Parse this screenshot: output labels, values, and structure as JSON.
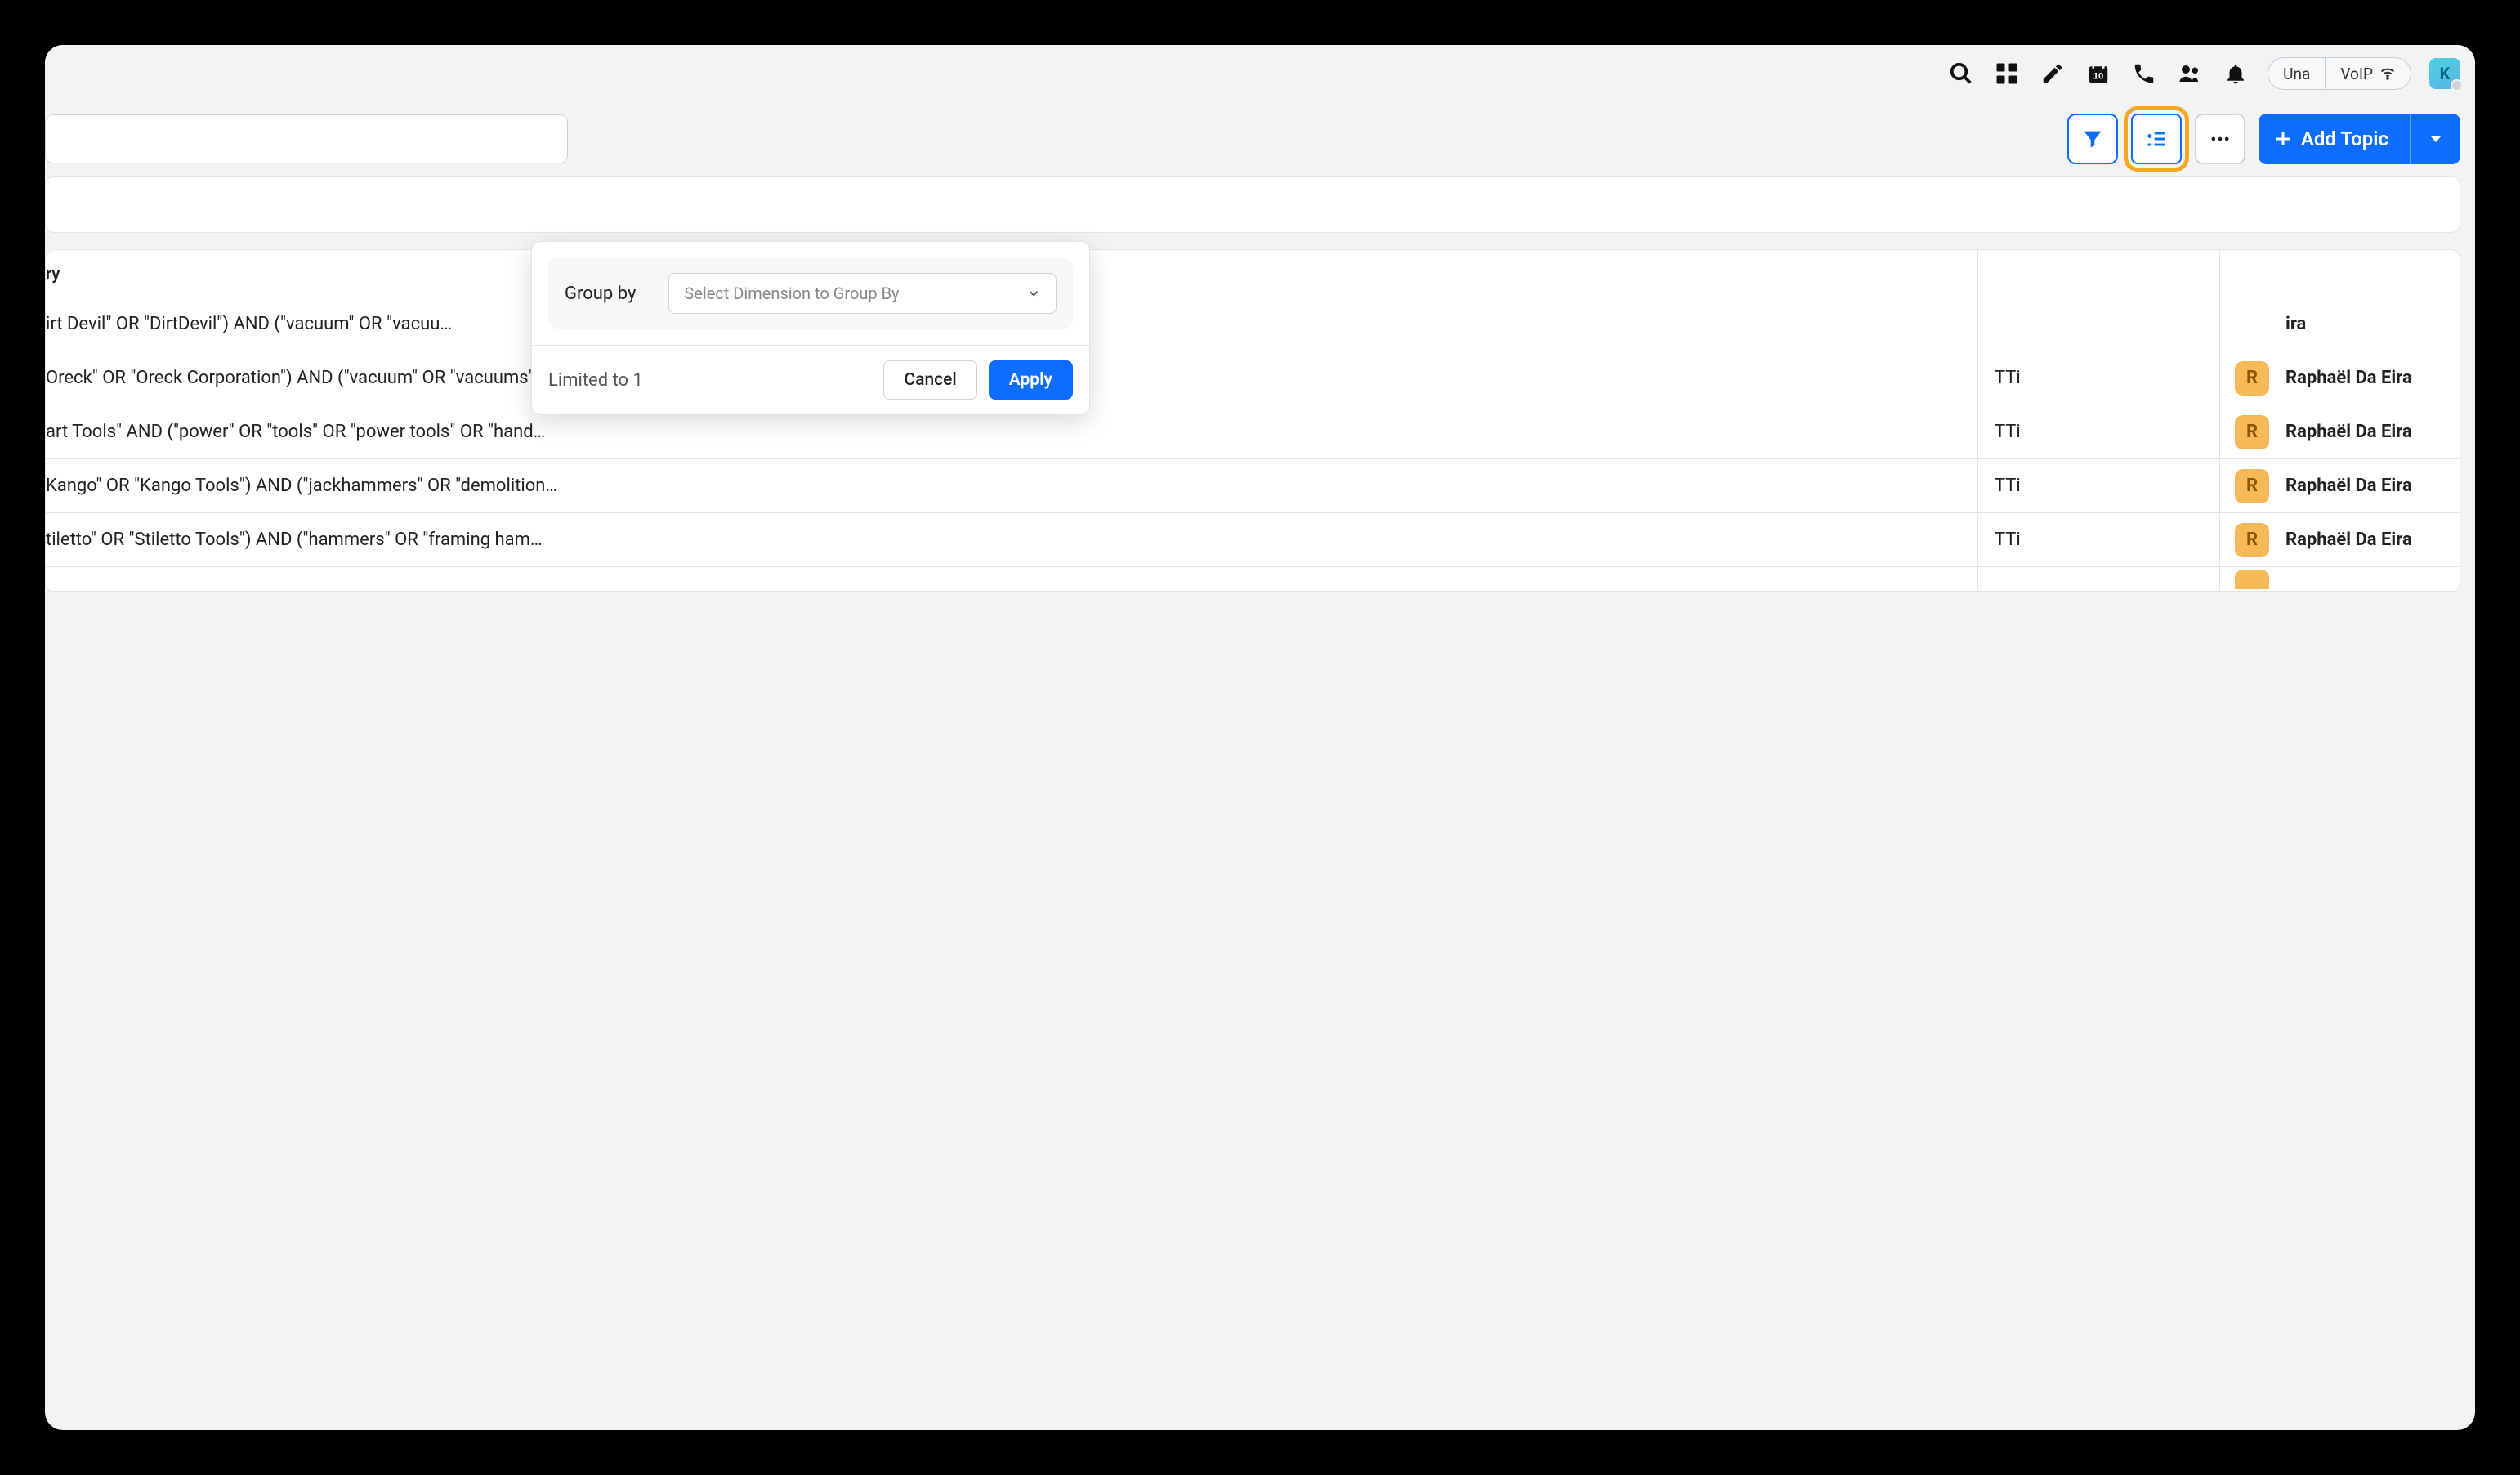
{
  "header": {
    "user_badge": "Una",
    "voip_label": "VoIP",
    "avatar_letter": "K"
  },
  "toolbar": {
    "add_label": "Add Topic"
  },
  "popover": {
    "group_by_label": "Group by",
    "select_placeholder": "Select Dimension to Group By",
    "limited_text": "Limited to 1",
    "cancel_label": "Cancel",
    "apply_label": "Apply"
  },
  "table": {
    "header_query_fragment": "ry",
    "rows": [
      {
        "query": "irt Devil\" OR \"DirtDevil\") AND (\"vacuum\" OR \"vacuu…",
        "customer": "",
        "owner": "ira",
        "owner_tag": ""
      },
      {
        "query": "Oreck\" OR \"Oreck Corporation\") AND (\"vacuum\" OR \"vacuums\" …",
        "customer": "TTi",
        "owner": "Raphaël Da Eira",
        "owner_tag": "R"
      },
      {
        "query": "art Tools\" AND (\"power\" OR \"tools\" OR \"power tools\" OR \"hand…",
        "customer": "TTi",
        "owner": "Raphaël Da Eira",
        "owner_tag": "R"
      },
      {
        "query": "Kango\" OR \"Kango Tools\") AND (\"jackhammers\" OR \"demolition…",
        "customer": "TTi",
        "owner": "Raphaël Da Eira",
        "owner_tag": "R"
      },
      {
        "query": "tiletto\" OR \"Stiletto Tools\") AND (\"hammers\" OR \"framing ham…",
        "customer": "TTi",
        "owner": "Raphaël Da Eira",
        "owner_tag": "R"
      }
    ]
  }
}
